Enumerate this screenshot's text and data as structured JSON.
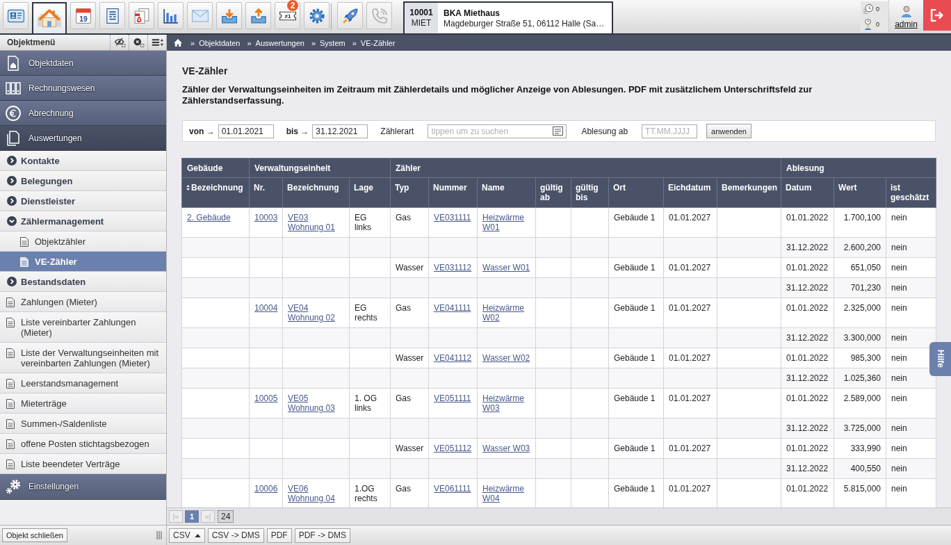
{
  "toolbar": {
    "groups": [
      {
        "buttons": [
          {
            "selected": false,
            "disabled": false
          },
          {
            "selected": true,
            "disabled": false
          },
          {
            "selected": false,
            "disabled": false,
            "icon_text": "19"
          },
          {
            "selected": false,
            "disabled": false
          },
          {
            "selected": false,
            "disabled": false
          },
          {
            "selected": false,
            "disabled": false
          },
          {
            "selected": false,
            "disabled": false
          },
          {
            "selected": false,
            "disabled": false
          },
          {
            "selected": false,
            "disabled": false
          },
          {
            "selected": false,
            "disabled": false,
            "icon_text": "#1",
            "badge": "2"
          },
          {
            "selected": false,
            "disabled": false
          }
        ]
      },
      {
        "buttons": [
          {
            "selected": false,
            "disabled": false
          },
          {
            "selected": false,
            "disabled": true
          }
        ]
      }
    ]
  },
  "object": {
    "number": "10001",
    "type": "MIET",
    "name": "BKA Miethaus",
    "address": "Magdeburger Straße 51, 06112 Halle (Sa…"
  },
  "counters": [
    {
      "value": "0"
    },
    {
      "value": "0"
    }
  ],
  "user": {
    "name": "admin"
  },
  "sidebar": {
    "title": "Objektmenü",
    "items": [
      {
        "kind": "section",
        "label": "Objektdaten",
        "selected": false
      },
      {
        "kind": "section",
        "label": "Rechnungswesen",
        "selected": false
      },
      {
        "kind": "section",
        "label": "Abrechnung",
        "selected": false
      },
      {
        "kind": "section",
        "label": "Auswertungen",
        "selected": true,
        "children": [
          {
            "kind": "group",
            "label": "Kontakte",
            "expanded": false
          },
          {
            "kind": "group",
            "label": "Belegungen",
            "expanded": false
          },
          {
            "kind": "group",
            "label": "Dienstleister",
            "expanded": false
          },
          {
            "kind": "group",
            "label": "Zählermanagement",
            "expanded": true,
            "children": [
              {
                "kind": "page",
                "label": "Objektzähler",
                "selected": false
              },
              {
                "kind": "page",
                "label": "VE-Zähler",
                "selected": true
              }
            ]
          },
          {
            "kind": "group",
            "label": "Bestandsdaten",
            "expanded": false
          },
          {
            "kind": "page",
            "label": "Zahlungen (Mieter)",
            "selected": false
          },
          {
            "kind": "page",
            "label": "Liste vereinbarter Zahlungen (Mieter)",
            "selected": false
          },
          {
            "kind": "page",
            "label": "Liste der Verwaltungseinheiten mit vereinbarten Zahlungen (Mieter)",
            "selected": false
          },
          {
            "kind": "page",
            "label": "Leerstandsmanagement",
            "selected": false
          },
          {
            "kind": "page",
            "label": "Mieterträge",
            "selected": false
          },
          {
            "kind": "page",
            "label": "Summen-/Saldenliste",
            "selected": false
          },
          {
            "kind": "page",
            "label": "offene Posten stichtagsbezogen",
            "selected": false
          },
          {
            "kind": "page",
            "label": "Liste beendeter Verträge",
            "selected": false
          }
        ]
      },
      {
        "kind": "section",
        "label": "Einstellungen",
        "selected": false
      }
    ],
    "close_button": "Objekt schließen"
  },
  "breadcrumb": [
    {
      "prefix": "»",
      "label": "Objektdaten"
    },
    {
      "prefix": "»",
      "label": "Auswertungen"
    },
    {
      "prefix": "»",
      "label": "System"
    },
    {
      "prefix": "»",
      "label": "VE-Zähler"
    }
  ],
  "page": {
    "title": "VE-Zähler",
    "description": "Zähler der Verwaltungseinheiten im Zeitraum mit Zählerdetails und möglicher Anzeige von Ablesungen. PDF mit zusätzlichem Unterschriftsfeld zur Zählerstandserfassung."
  },
  "filter": {
    "fields": [
      {
        "kind": "range",
        "label": "von →",
        "value": "01.01.2021"
      },
      {
        "kind": "range",
        "label": "bis →",
        "value": "31.12.2021"
      },
      {
        "kind": "search",
        "label": "Zählerart",
        "placeholder": "tippen um zu suchen"
      },
      {
        "kind": "date",
        "label": "Ablesung ab",
        "placeholder": "TT.MM.JJJJ"
      }
    ],
    "button": "anwenden"
  },
  "table": {
    "column_groups": [
      {
        "label": "Gebäude",
        "columns": [
          {
            "label": "Bezeichnung",
            "kind": "link",
            "sortable": true
          }
        ]
      },
      {
        "label": "Verwaltungseinheit",
        "columns": [
          {
            "label": "Nr.",
            "kind": "link",
            "sortable": false
          },
          {
            "label": "Bezeichnung",
            "kind": "link",
            "sortable": false
          },
          {
            "label": "Lage",
            "kind": "text",
            "sortable": false
          }
        ]
      },
      {
        "label": "Zähler",
        "columns": [
          {
            "label": "Typ",
            "kind": "text",
            "sortable": false
          },
          {
            "label": "Nummer",
            "kind": "link",
            "sortable": false
          },
          {
            "label": "Name",
            "kind": "link",
            "sortable": false
          },
          {
            "label": "gültig ab",
            "kind": "text",
            "sortable": false
          },
          {
            "label": "gültig bis",
            "kind": "text",
            "sortable": false
          },
          {
            "label": "Ort",
            "kind": "text",
            "sortable": false
          },
          {
            "label": "Eichdatum",
            "kind": "text",
            "sortable": false
          },
          {
            "label": "Bemerkungen",
            "kind": "text",
            "sortable": false
          }
        ]
      },
      {
        "label": "Ablesung",
        "columns": [
          {
            "label": "Datum",
            "kind": "text",
            "sortable": false
          },
          {
            "label": "Wert",
            "kind": "number",
            "sortable": false
          },
          {
            "label": "ist geschätzt",
            "kind": "text",
            "sortable": false
          }
        ]
      }
    ],
    "rows": [
      [
        "2. Gebäude",
        "10003",
        "VE03 Wohnung 01",
        "EG links",
        "Gas",
        "VE031111",
        "Heizwärme W01",
        null,
        null,
        "Gebäude 1",
        "01.01.2027",
        null,
        "01.01.2022",
        "1.700,100",
        "nein"
      ],
      [
        null,
        null,
        null,
        null,
        null,
        null,
        null,
        null,
        null,
        null,
        null,
        null,
        "31.12.2022",
        "2.600,200",
        "nein"
      ],
      [
        null,
        null,
        null,
        null,
        "Wasser",
        "VE031112",
        "Wasser W01",
        null,
        null,
        "Gebäude 1",
        "01.01.2027",
        null,
        "01.01.2022",
        "651,050",
        "nein"
      ],
      [
        null,
        null,
        null,
        null,
        null,
        null,
        null,
        null,
        null,
        null,
        null,
        null,
        "31.12.2022",
        "701,230",
        "nein"
      ],
      [
        null,
        "10004",
        "VE04 Wohnung 02",
        "EG rechts",
        "Gas",
        "VE041111",
        "Heizwärme W02",
        null,
        null,
        "Gebäude 1",
        "01.01.2027",
        null,
        "01.01.2022",
        "2.325,000",
        "nein"
      ],
      [
        null,
        null,
        null,
        null,
        null,
        null,
        null,
        null,
        null,
        null,
        null,
        null,
        "31.12.2022",
        "3.300,000",
        "nein"
      ],
      [
        null,
        null,
        null,
        null,
        "Wasser",
        "VE041112",
        "Wasser W02",
        null,
        null,
        "Gebäude 1",
        "01.01.2027",
        null,
        "01.01.2022",
        "985,300",
        "nein"
      ],
      [
        null,
        null,
        null,
        null,
        null,
        null,
        null,
        null,
        null,
        null,
        null,
        null,
        "31.12.2022",
        "1.025,360",
        "nein"
      ],
      [
        null,
        "10005",
        "VE05 Wohnung 03",
        "1. OG links",
        "Gas",
        "VE051111",
        "Heizwärme W03",
        null,
        null,
        "Gebäude 1",
        "01.01.2027",
        null,
        "01.01.2022",
        "2.589,000",
        "nein"
      ],
      [
        null,
        null,
        null,
        null,
        null,
        null,
        null,
        null,
        null,
        null,
        null,
        null,
        "31.12.2022",
        "3.725,000",
        "nein"
      ],
      [
        null,
        null,
        null,
        null,
        "Wasser",
        "VE051112",
        "Wasser W03",
        null,
        null,
        "Gebäude 1",
        "01.01.2027",
        null,
        "01.01.2022",
        "333,990",
        "nein"
      ],
      [
        null,
        null,
        null,
        null,
        null,
        null,
        null,
        null,
        null,
        null,
        null,
        null,
        "31.12.2022",
        "400,550",
        "nein"
      ],
      [
        null,
        "10006",
        "VE06 Wohnung 04",
        "1.OG rechts",
        "Gas",
        "VE061111",
        "Heizwärme W04",
        null,
        null,
        "Gebäude 1",
        "01.01.2027",
        null,
        "01.01.2022",
        "5.815,000",
        "nein"
      ]
    ]
  },
  "pagination": {
    "first": {
      "label": "|«",
      "disabled": true
    },
    "pages": [
      {
        "label": "1",
        "selected": true
      }
    ],
    "last": {
      "label": "»|",
      "disabled": true
    },
    "page_size": "24"
  },
  "exports": [
    {
      "label": "CSV",
      "has_menu": true
    },
    {
      "label": "CSV -> DMS",
      "has_menu": false
    },
    {
      "label": "PDF",
      "has_menu": false
    },
    {
      "label": "PDF -> DMS",
      "has_menu": false
    }
  ],
  "help_tab": {
    "label": "Hilfe"
  }
}
